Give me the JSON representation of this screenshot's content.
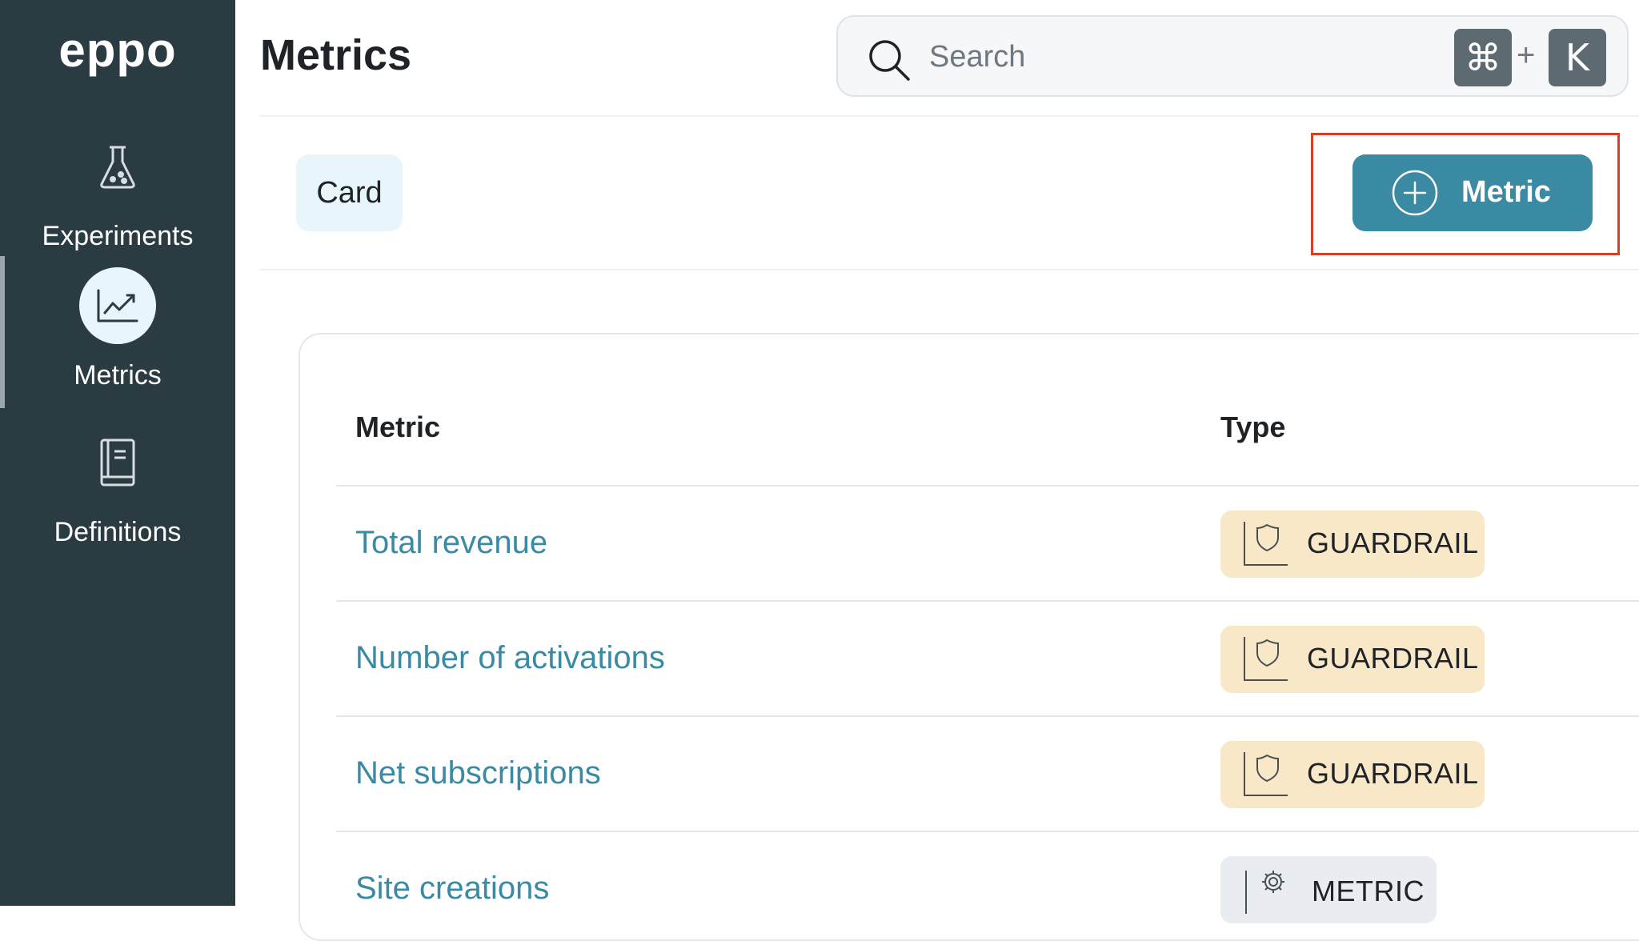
{
  "brand": {
    "logo_text": "eppo"
  },
  "sidebar": {
    "items": [
      {
        "label": "Experiments",
        "icon": "flask-icon",
        "active": false
      },
      {
        "label": "Metrics",
        "icon": "trend-chart-icon",
        "active": true
      },
      {
        "label": "Definitions",
        "icon": "book-icon",
        "active": false
      }
    ]
  },
  "header": {
    "title": "Metrics",
    "search": {
      "placeholder": "Search",
      "shortcut_modifier": "⌘",
      "shortcut_separator": "+",
      "shortcut_key": "K"
    }
  },
  "toolbar": {
    "card_tab_label": "Card",
    "add_metric_label": "Metric"
  },
  "table": {
    "columns": [
      "Metric",
      "Type"
    ],
    "rows": [
      {
        "name": "Total revenue",
        "type": "GUARDRAIL"
      },
      {
        "name": "Number of activations",
        "type": "GUARDRAIL"
      },
      {
        "name": "Net subscriptions",
        "type": "GUARDRAIL"
      },
      {
        "name": "Site creations",
        "type": "METRIC"
      }
    ]
  },
  "colors": {
    "sidebar_bg": "#2b3b42",
    "accent": "#3b8aa3",
    "highlight": "#d6402b",
    "guardrail_badge": "#f9e8c7",
    "metric_badge": "#e9edf1"
  }
}
